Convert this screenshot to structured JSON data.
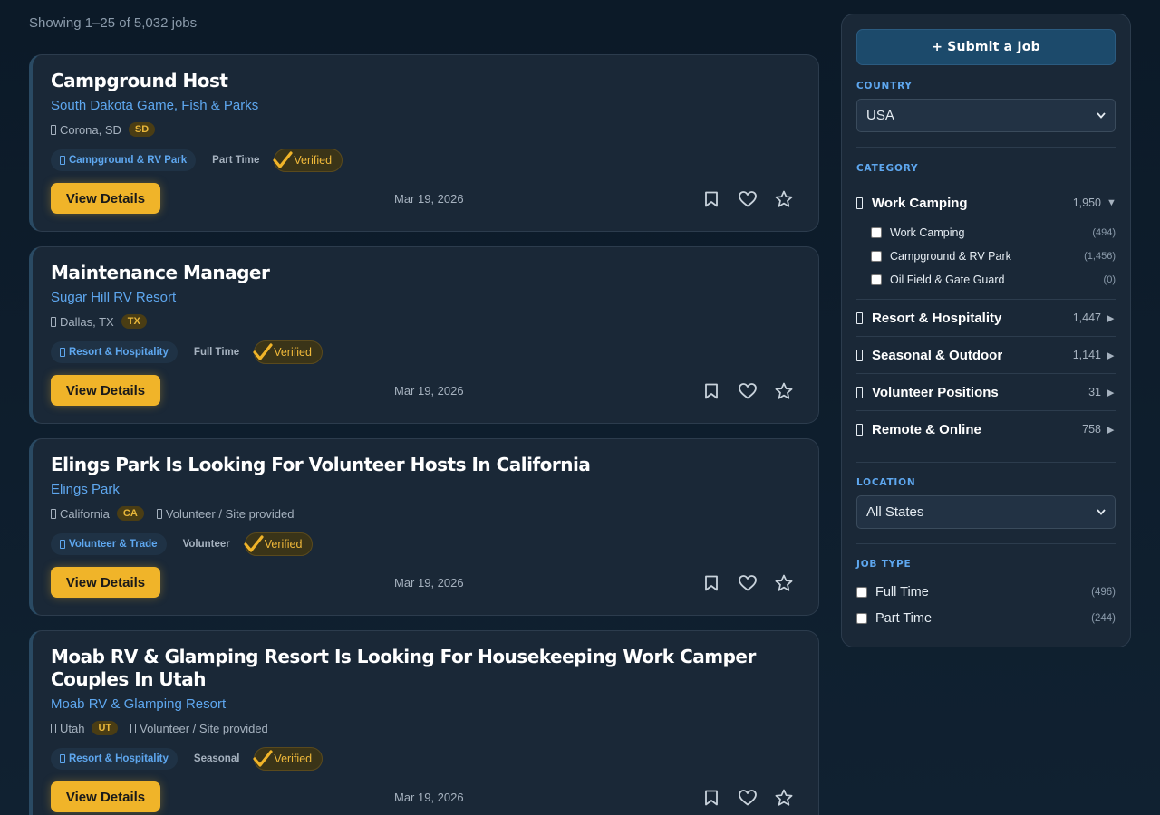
{
  "results": {
    "summary": "Showing 1–25 of 5,032 jobs"
  },
  "jobs": [
    {
      "title": "Campground Host",
      "company": "South Dakota Game, Fish & Parks",
      "location": "Corona, SD",
      "state": "SD",
      "compensation": "",
      "category": "Campground & RV Park",
      "job_type": "Part Time",
      "verified": "Verified",
      "action": "View Details",
      "date": "Mar 19, 2026"
    },
    {
      "title": "Maintenance Manager",
      "company": "Sugar Hill RV Resort",
      "location": "Dallas, TX",
      "state": "TX",
      "compensation": "",
      "category": "Resort & Hospitality",
      "job_type": "Full Time",
      "verified": "Verified",
      "action": "View Details",
      "date": "Mar 19, 2026"
    },
    {
      "title": "Elings Park Is Looking For Volunteer Hosts In California",
      "company": "Elings Park",
      "location": "California",
      "state": "CA",
      "compensation": "Volunteer / Site provided",
      "category": "Volunteer & Trade",
      "job_type": "Volunteer",
      "verified": "Verified",
      "action": "View Details",
      "date": "Mar 19, 2026"
    },
    {
      "title": "Moab RV & Glamping Resort Is Looking For Housekeeping Work Camper Couples In Utah",
      "company": "Moab RV & Glamping Resort",
      "location": "Utah",
      "state": "UT",
      "compensation": "Volunteer / Site provided",
      "category": "Resort & Hospitality",
      "job_type": "Seasonal",
      "verified": "Verified",
      "action": "View Details",
      "date": "Mar 19, 2026"
    }
  ],
  "sidebar": {
    "submit_label": "+ Submit a Job",
    "country": {
      "label": "COUNTRY",
      "selected": "USA"
    },
    "category": {
      "label": "CATEGORY",
      "groups": [
        {
          "name": "Work Camping",
          "count": "1,950",
          "arrow": "▼",
          "children": [
            {
              "name": "Work Camping",
              "count": "(494)"
            },
            {
              "name": "Campground & RV Park",
              "count": "(1,456)"
            },
            {
              "name": "Oil Field & Gate Guard",
              "count": "(0)"
            }
          ]
        },
        {
          "name": "Resort & Hospitality",
          "count": "1,447",
          "arrow": "▶"
        },
        {
          "name": "Seasonal & Outdoor",
          "count": "1,141",
          "arrow": "▶"
        },
        {
          "name": "Volunteer Positions",
          "count": "31",
          "arrow": "▶"
        },
        {
          "name": "Remote & Online",
          "count": "758",
          "arrow": "▶"
        }
      ]
    },
    "location": {
      "label": "LOCATION",
      "selected": "All States"
    },
    "job_type": {
      "label": "JOB TYPE",
      "options": [
        {
          "name": "Full Time",
          "count": "(496)"
        },
        {
          "name": "Part Time",
          "count": "(244)"
        }
      ]
    }
  },
  "icons": [
    "bookmark-icon",
    "heart-icon",
    "star-icon",
    "checkmark-icon",
    "chevron-down-icon"
  ],
  "colors": {
    "accent": "#f0b429",
    "link": "#5ea7ef",
    "background": "#0d1b2a",
    "card": "#1a2837"
  }
}
